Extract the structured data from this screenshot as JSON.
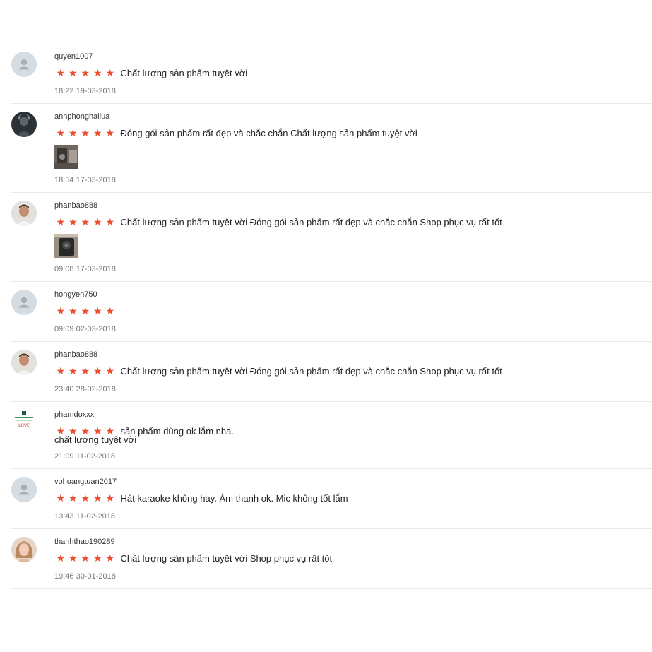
{
  "colors": {
    "star": "#ee4d2d",
    "divider": "#e8e8e8",
    "timestamp": "#777777"
  },
  "reviews": [
    {
      "username": "quyen1007",
      "rating": 5,
      "comment": "Chất lượng sản phẩm tuyệt vời",
      "comment_cont": "",
      "time": "18:22 19-03-2018",
      "avatar": "default-user-icon",
      "has_photo": false
    },
    {
      "username": "anhphonghailua",
      "rating": 5,
      "comment": "Đóng gói sản phẩm rất đẹp và chắc chắn Chất lượng sản phẩm tuyệt vời",
      "comment_cont": "",
      "time": "18:54 17-03-2018",
      "avatar": "user-photo",
      "has_photo": true
    },
    {
      "username": "phanbao888",
      "rating": 5,
      "comment": "Chất lượng sản phẩm tuyệt vời Đóng gói sản phẩm rất đẹp và chắc chắn Shop phục vụ rất tốt",
      "comment_cont": "",
      "time": "09:08 17-03-2018",
      "avatar": "user-photo",
      "has_photo": true
    },
    {
      "username": "hongyen750",
      "rating": 5,
      "comment": "",
      "comment_cont": "",
      "time": "09:09 02-03-2018",
      "avatar": "default-user-icon",
      "has_photo": false
    },
    {
      "username": "phanbao888",
      "rating": 5,
      "comment": "Chất lượng sản phẩm tuyệt vời Đóng gói sản phẩm rất đẹp và chắc chắn Shop phục vụ rất tốt",
      "comment_cont": "",
      "time": "23:40 28-02-2018",
      "avatar": "user-photo",
      "has_photo": false
    },
    {
      "username": "phamdoxxx",
      "rating": 5,
      "comment": "sản phẩm dùng ok lắm nha.",
      "comment_cont": "chất lượng tuyệt vời",
      "time": "21:09 11-02-2018",
      "avatar": "user-photo",
      "has_photo": false
    },
    {
      "username": "vohoangtuan2017",
      "rating": 5,
      "comment": "Hát karaoke không hay. Âm thanh ok. Mic không tốt lắm",
      "comment_cont": "",
      "time": "13:43 11-02-2018",
      "avatar": "default-user-icon",
      "has_photo": false
    },
    {
      "username": "thanhthao190289",
      "rating": 5,
      "comment": "Chất lượng sản phẩm tuyệt vời  Shop phục vụ rất tốt",
      "comment_cont": "",
      "time": "19:46 30-01-2018",
      "avatar": "user-photo",
      "has_photo": false
    }
  ]
}
